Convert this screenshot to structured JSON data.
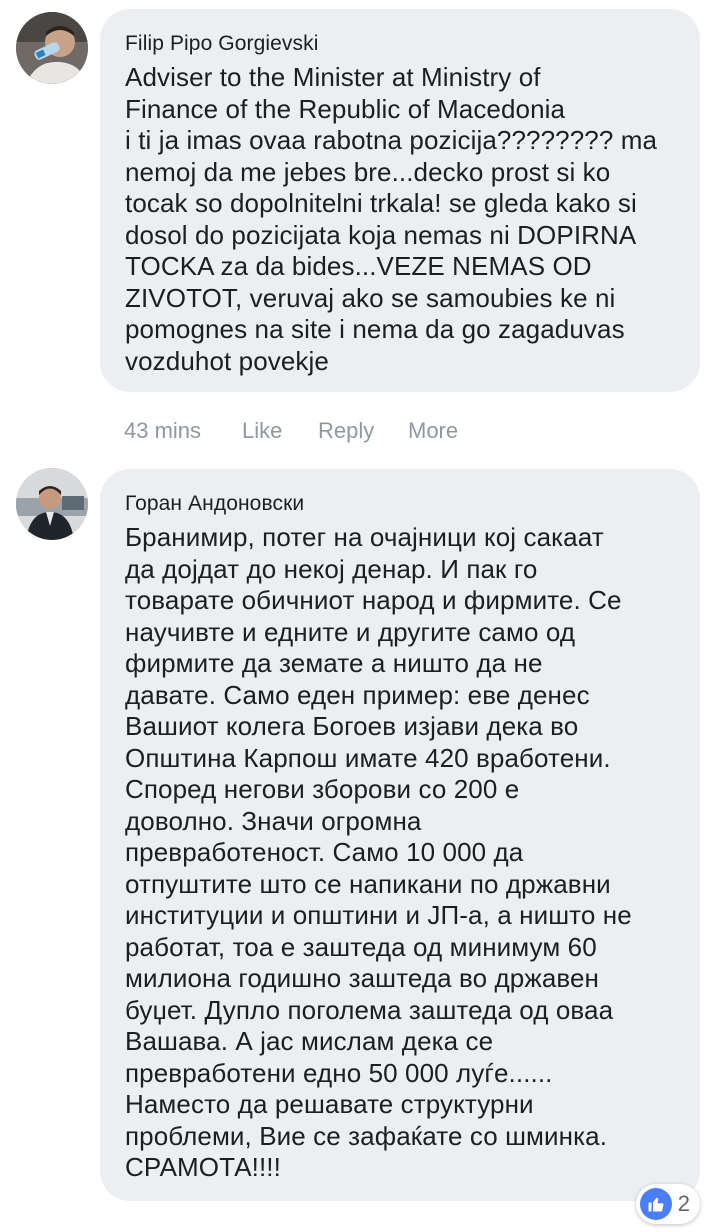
{
  "comments": [
    {
      "author": "Filip Pipo Gorgievski",
      "text": "Adviser to the Minister at Ministry of\nFinance of the Republic of Macedonia\ni ti ja imas ovaa rabotna pozicija???????? ma\nnemoj da me jebes bre...decko prost si ko\ntocak so dopolnitelni trkala! se gleda kako si\ndosol do pozicijata koja nemas ni DOPIRNA\nTOCKA za da bides...VEZE NEMAS OD\nZIVOTOT, veruvaj ako se samoubies ke ni\npomognes na site i nema da go zagaduvas\nvozduhot povekje",
      "time": "43 mins",
      "like_label": "Like",
      "reply_label": "Reply",
      "more_label": "More",
      "avatar_icon": "person-drinking-avatar"
    },
    {
      "author": "Горан Андоновски",
      "text": "Бранимир, потег на очајници кој сакаат\nда дојдат до некој денар. И пак го\nтоварате обичниот народ и фирмите. Се\nнаучивте и едните и другите само од\nфирмите да земате а ништо да не\nдавате. Само еден пример: еве денес\nВашиот колега Богоев изјави дека во\nОпштина Карпош имате 420 вработени.\nСпоред негови зборови со 200 е\nдоволно. Значи огромна\nпревработеност. Само 10 000 да\nотпуштите што се напикани по државни\nинституции и општини и ЈП-а, а ништо не\nработат, тоа е заштеда од минимум 60\nмилиона годишно заштеда во државен\nбуџет. Дупло поголема заштеда од оваа\nВашава. А јас мислам дека се\nпревработени едно 50 000 луѓе......\nНаместо да решавате структурни\nпроблеми, Вие се зафаќате со шминка.\nСРАМОТА!!!!",
      "reaction_count": "2",
      "avatar_icon": "person-suit-avatar"
    }
  ],
  "colors": {
    "bubble": "#eceef1",
    "like_blue": "#4a7ef6",
    "meta_gray": "#9097a0"
  }
}
